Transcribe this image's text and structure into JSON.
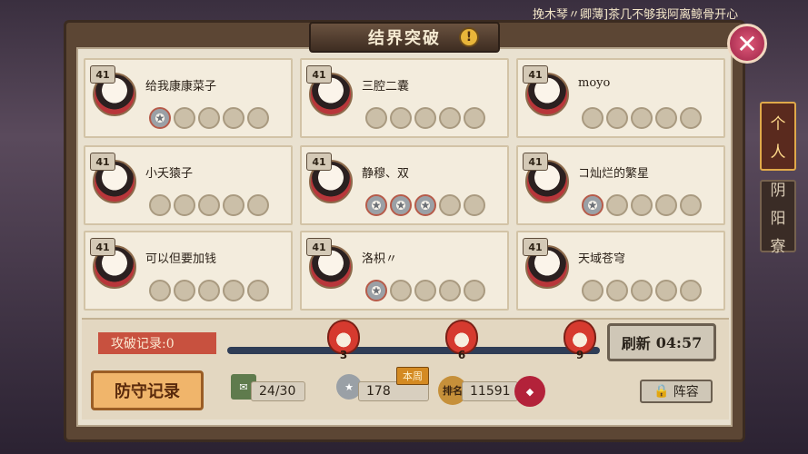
{
  "marquee": "挽木琴〃卿薄]茶几不够我阿离鲸骨开心",
  "title": "结界突破",
  "warn_icon": "!",
  "close_icon": "✕",
  "side_tabs": [
    {
      "label_top": "个",
      "label_bottom": "人"
    },
    {
      "label_top": "阴",
      "label_mid": "阳",
      "label_bottom": "寮"
    }
  ],
  "cards": [
    {
      "level": "41",
      "name": "给我康康菜子",
      "stars_done": 1
    },
    {
      "level": "41",
      "name": "三腔二囊",
      "stars_done": 0
    },
    {
      "level": "41",
      "name": "moyo",
      "stars_done": 0
    },
    {
      "level": "41",
      "name": "小夭猿子",
      "stars_done": 0
    },
    {
      "level": "41",
      "name": "静穆、双",
      "stars_done": 3
    },
    {
      "level": "41",
      "name": "コ灿烂的繁星",
      "stars_done": 1
    },
    {
      "level": "41",
      "name": "可以但要加钱",
      "stars_done": 0
    },
    {
      "level": "41",
      "name": "洛枳〃",
      "stars_done": 1
    },
    {
      "level": "41",
      "name": "天域苍穹",
      "stars_done": 0
    }
  ],
  "record": {
    "label": "攻破记录:0",
    "progress": 0
  },
  "milestones": [
    "3",
    "6",
    "9"
  ],
  "refresh": {
    "label": "刷新",
    "time": "04:57"
  },
  "defense_button": "防守记录",
  "stats": {
    "tickets": "24/30",
    "medals": "178",
    "weekly_badge": "本周",
    "rank_icon": "排名",
    "rank": "11591"
  },
  "lineup_button": "阵容"
}
